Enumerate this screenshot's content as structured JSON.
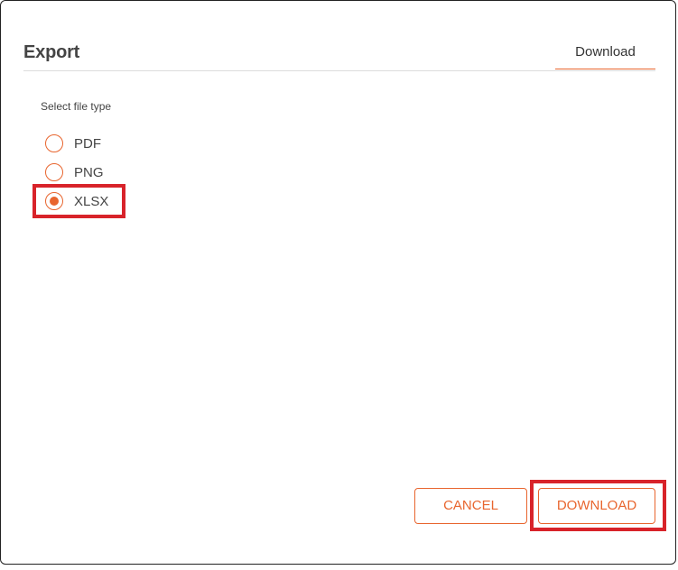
{
  "dialog": {
    "title": "Export",
    "tab_label": "Download"
  },
  "file_type": {
    "label": "Select file type",
    "options": [
      {
        "label": "PDF",
        "selected": false
      },
      {
        "label": "PNG",
        "selected": false
      },
      {
        "label": "XLSX",
        "selected": true
      }
    ]
  },
  "footer": {
    "cancel_label": "CANCEL",
    "download_label": "DOWNLOAD"
  },
  "colors": {
    "accent": "#e8652e",
    "highlight": "#d8232a"
  }
}
